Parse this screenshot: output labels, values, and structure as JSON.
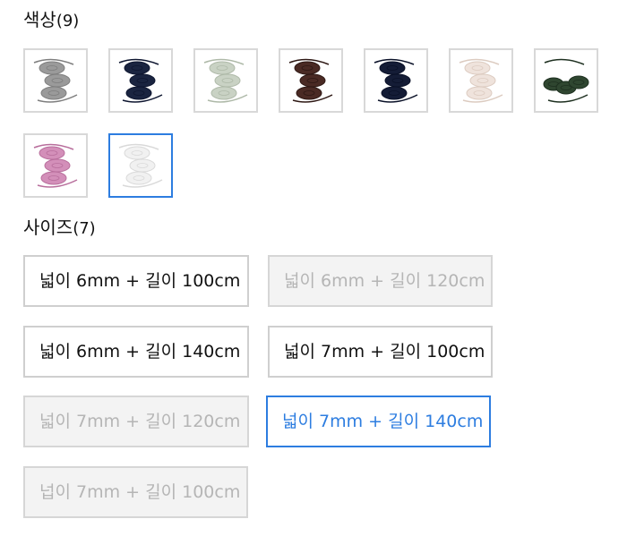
{
  "color_section": {
    "title": "색상",
    "count": "(9)",
    "swatches": [
      {
        "name": "gray",
        "color": "#9a9a9a",
        "shade": "#7e7e7e"
      },
      {
        "name": "navy",
        "color": "#1a2440",
        "shade": "#0e1630"
      },
      {
        "name": "sage",
        "color": "#c9d2c4",
        "shade": "#aeb9a8"
      },
      {
        "name": "brown",
        "color": "#4a2a24",
        "shade": "#2e1814"
      },
      {
        "name": "dark-navy",
        "color": "#141c36",
        "shade": "#0a1128"
      },
      {
        "name": "ivory",
        "color": "#efe3dc",
        "shade": "#dccbc0"
      },
      {
        "name": "dark-green",
        "color": "#2f4630",
        "shade": "#1e3020"
      },
      {
        "name": "pink",
        "color": "#d38fb9",
        "shade": "#b86e9c"
      },
      {
        "name": "white",
        "color": "#f1f1f1",
        "shade": "#d9d9d9"
      }
    ],
    "selected_index": 8
  },
  "size_section": {
    "title": "사이즈",
    "count": "(7)",
    "options": [
      {
        "label": "넓이 6mm + 길이 100cm",
        "state": "available"
      },
      {
        "label": "넓이 6mm + 길이 120cm",
        "state": "disabled"
      },
      {
        "label": "넓이 6mm + 길이 140cm",
        "state": "available"
      },
      {
        "label": "넓이 7mm + 길이 100cm",
        "state": "available"
      },
      {
        "label": "넓이 7mm + 길이 120cm",
        "state": "disabled"
      },
      {
        "label": "넓이 7mm + 길이 140cm",
        "state": "selected"
      },
      {
        "label": "넙이 7mm + 길이 100cm",
        "state": "disabled"
      }
    ]
  },
  "colors": {
    "accent": "#2d7de0",
    "border": "#cfcfcf",
    "disabled_bg": "#f3f3f3",
    "disabled_text": "#b5b5b5"
  }
}
